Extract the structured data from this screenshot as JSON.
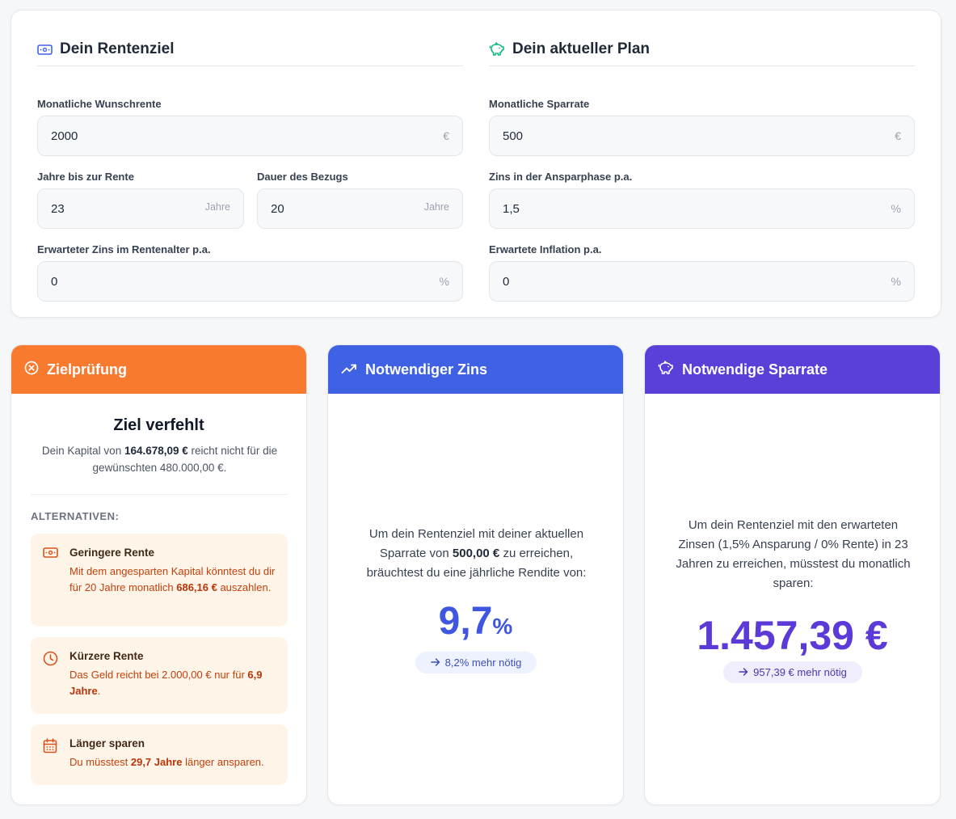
{
  "goal_section": {
    "title": "Dein Rentenziel",
    "monthly_pension": {
      "label": "Monatliche Wunschrente",
      "value": "2000",
      "unit": "€"
    },
    "years_to_retirement": {
      "label": "Jahre bis zur Rente",
      "value": "23",
      "unit": "Jahre"
    },
    "payout_duration": {
      "label": "Dauer des Bezugs",
      "value": "20",
      "unit": "Jahre"
    },
    "retirement_rate": {
      "label": "Erwarteter Zins im Rentenalter p.a.",
      "value": "0",
      "unit": "%"
    }
  },
  "plan_section": {
    "title": "Dein aktueller Plan",
    "monthly_savings": {
      "label": "Monatliche Sparrate",
      "value": "500",
      "unit": "€"
    },
    "savings_rate": {
      "label": "Zins in der Ansparphase p.a.",
      "value": "1,5",
      "unit": "%"
    },
    "inflation": {
      "label": "Erwartete Inflation p.a.",
      "value": "0",
      "unit": "%"
    }
  },
  "goal_check": {
    "header": "Zielprüfung",
    "title": "Ziel verfehlt",
    "desc_pre": "Dein Kapital von ",
    "desc_capital": "164.678,09 €",
    "desc_post": " reicht nicht für die gewünschten 480.000,00 €.",
    "alternatives_label": "ALTERNATIVEN:",
    "alt_lower_pension": {
      "title": "Geringere Rente",
      "text_pre": "Mit dem angesparten Kapital könntest du dir für 20 Jahre monatlich ",
      "amount": "686,16 €",
      "text_post": " auszahlen."
    },
    "alt_shorter_pension": {
      "title": "Kürzere Rente",
      "text_pre": "Das Geld reicht bei 2.000,00 € nur für ",
      "amount": "6,9 Jahre",
      "text_post": "."
    },
    "alt_save_longer": {
      "title": "Länger sparen",
      "text_pre": "Du müsstest ",
      "amount": "29,7 Jahre",
      "text_post": " länger ansparen."
    }
  },
  "required_rate": {
    "header": "Notwendiger Zins",
    "text_pre": "Um dein Rentenziel mit deiner aktuellen Sparrate von ",
    "amount": "500,00 €",
    "text_post": " zu erreichen, bräuchtest du eine jährliche Rendite von:",
    "value": "9,7",
    "unit": "%",
    "delta": "8,2% mehr nötig"
  },
  "required_savings": {
    "header": "Notwendige Sparrate",
    "text": "Um dein Rentenziel mit den erwarteten Zinsen (1,5% Ansparung / 0% Rente) in 23 Jahren zu erreichen, müsstest du monatlich sparen:",
    "value": "1.457,39 €",
    "delta": "957,39 € mehr nötig"
  },
  "colors": {
    "orange": "#f77a2e",
    "blue": "#3f62e4",
    "purple": "#5b3fd9",
    "green_icon": "#10b981"
  },
  "icons": [
    "banknote-icon",
    "piggy-bank-icon",
    "x-circle-icon",
    "trending-up-icon",
    "clock-icon",
    "calendar-icon",
    "arrow-right-icon"
  ]
}
